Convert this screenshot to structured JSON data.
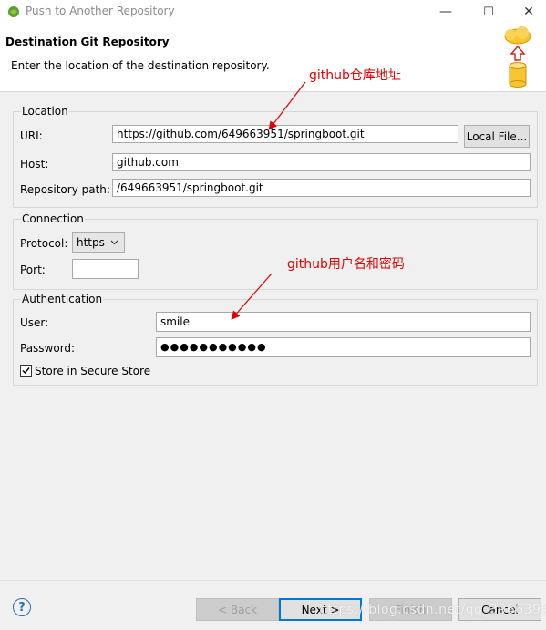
{
  "window": {
    "title": "Push to Another Repository",
    "minimize_glyph": "—",
    "maximize_glyph": "☐",
    "close_glyph": "✕"
  },
  "header": {
    "title": "Destination Git Repository",
    "description": "Enter the location of the destination repository."
  },
  "location": {
    "legend": "Location",
    "uri_label": "URI:",
    "uri_value": "https://github.com/649663951/springboot.git",
    "local_file_button": "Local File...",
    "host_label": "Host:",
    "host_value": "github.com",
    "path_label": "Repository path:",
    "path_value": "/649663951/springboot.git"
  },
  "connection": {
    "legend": "Connection",
    "protocol_label": "Protocol:",
    "protocol_value": "https",
    "port_label": "Port:",
    "port_value": ""
  },
  "authentication": {
    "legend": "Authentication",
    "user_label": "User:",
    "user_value": "smile",
    "password_label": "Password:",
    "password_value": "●●●●●●●●●●●",
    "store_label": "Store in Secure Store",
    "store_checked": true
  },
  "annotations": {
    "repo_address": "github仓库地址",
    "credentials": "github用户名和密码"
  },
  "footer": {
    "help_glyph": "?",
    "back_button": "< Back",
    "next_button": "Next >",
    "finish_button": "Finish",
    "cancel_button": "Cancel"
  },
  "watermark": "https://blog.csdn.net/qq_39663951",
  "colors": {
    "annotation": "#e00000",
    "default_button_border": "#0078d7",
    "help_icon": "#2d6db5"
  }
}
